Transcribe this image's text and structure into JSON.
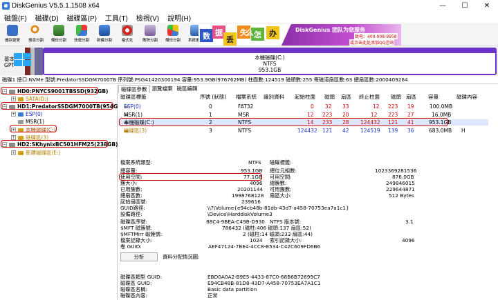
{
  "window": {
    "title": "DiskGenius V5.5.1.1508 x64"
  },
  "menu": [
    "磁盤(F)",
    "磁碟(D)",
    "磁碟區(P)",
    "工具(T)",
    "檢視(V)",
    "說明(H)"
  ],
  "toolbar": [
    "儲存變更",
    "搜尋分割",
    "備份分割",
    "快速分割",
    "新建分割",
    "格式化",
    "刪除分割",
    "備份分割",
    "系統遷移"
  ],
  "banner": {
    "cubes": [
      "数",
      "据",
      "丢",
      "失",
      "怎",
      "么",
      "办"
    ],
    "slogan": "DiskGenius 团队为您服务",
    "phone": "致电：400-008-9958",
    "qq": "或点击此处添加QQ咨询"
  },
  "diskmap": {
    "basic": "基本",
    "type": "GPT",
    "name": "本機磁碟(C:)",
    "fs": "NTFS",
    "size": "953.1GB"
  },
  "infobar": "磁碟1 接口:NVMe  型號:PredatorSSDGM7000TB  序列號:PSG41420300194  容量:953.9GB(976762MB)  柱面數:124519  磁頭數:255  每磁道扇區數:63  總扇區數:2000409264",
  "tree": {
    "d0": "HD0:PNYCS9001TBSSD(932GB)",
    "d0p1": "SATA(D:)",
    "d1": "HD1:PredatorSSDGM7000TB(954GB)",
    "d1p1": "ESP(0)",
    "d1p2": "MSR(1)",
    "d1p3": "本機磁碟(C:)",
    "d1p4": "磁碟區(3)",
    "d2": "HD2:SKhynixBC501HFM25(238GB)",
    "d2p1": "新建磁碟區(E:)"
  },
  "tabs": [
    "磁碟區參數",
    "瀏覽檔案",
    "磁區編輯"
  ],
  "table": {
    "headers": [
      "磁碟區標籤",
      "序號 (狀態)",
      "檔案系統",
      "識別資料",
      "起始柱面",
      "磁頭",
      "扇區",
      "終止柱面",
      "磁頭",
      "扇區",
      "容量",
      "磁碟內容"
    ],
    "rows": [
      {
        "label": "ESP(0)",
        "seq": "0",
        "fs": "FAT32",
        "sc": "0",
        "sh": "32",
        "ss": "33",
        "ec": "12",
        "eh": "223",
        "es": "19",
        "cap": "100.0MB",
        "attr": ""
      },
      {
        "label": "MSR(1)",
        "seq": "1",
        "fs": "MSR",
        "sc": "12",
        "sh": "223",
        "ss": "20",
        "ec": "12",
        "eh": "223",
        "es": "27",
        "cap": "16.0MB",
        "attr": ""
      },
      {
        "label": "本機磁碟(C:)",
        "seq": "2",
        "fs": "NTFS",
        "sc": "14",
        "sh": "233",
        "ss": "28",
        "ec": "124432",
        "eh": "121",
        "es": "41",
        "cap": "953.1GB",
        "attr": ""
      },
      {
        "label": "磁碟區(3)",
        "seq": "3",
        "fs": "NTFS",
        "sc": "124432",
        "sh": "121",
        "ss": "42",
        "ec": "124519",
        "eh": "139",
        "es": "36",
        "cap": "683.0MB",
        "attr": "H"
      }
    ]
  },
  "details": {
    "fs_type_label": "檔案系統類型:",
    "fs_type": "NTFS",
    "vol_label_l": "磁碟標籤:",
    "cap_l": "總容量:",
    "cap": "953.1GB",
    "total_bytes_l": "總位元組數:",
    "total_bytes": "1023369281536",
    "used_l": "使用空間:",
    "used": "77.1GB",
    "free_l": "可用空間:",
    "free": "876.0GB",
    "cluster_l": "簇大小:",
    "cluster": "4096",
    "total_clusters_l": "總簇數:",
    "total_clusters": "249846015",
    "used_clusters_l": "已用簇數:",
    "used_clusters": "20201144",
    "free_clusters_l": "可用簇數:",
    "free_clusters": "229644871",
    "sectors_l": "總扇區數:",
    "sectors": "1998768128",
    "sector_size_l": "扇區大小:",
    "sector_size": "512 Bytes",
    "start_sector_l": "起始扇區號:",
    "start_sector": "239616",
    "guid_path_l": "GUID路徑:",
    "guid_path": "\\\\?\\Volume{e94cb48b-81db-43d7-a458-70753ea7a1c1}",
    "device_path_l": "設備路徑:",
    "device_path": "\\Device\\HarddiskVolume3",
    "serial_l": "磁碟區序號:",
    "serial": "88C4-9BEA-C49B-D930",
    "ntfs_ver_l": "NTFS 版本號:",
    "ntfs_ver": "3.1",
    "mft_l": "$MFT 磁簇號:",
    "mft": "786432 (磁柱:406 磁頭:137 扇區:52)",
    "mftmirr_l": "$MFTMirr 磁簇號:",
    "mftmirr": "2 (磁柱:14 磁頭:233 扇區:44)",
    "frs_l": "檔案記錄大小:",
    "frs": "1024",
    "idx_l": "索引記錄大小:",
    "idx": "4096",
    "vol_guid_l": "卷 GUID:",
    "vol_guid": "AEF47124-7BE4-4CC8-B534-C42C609FD6B6",
    "analyze": "分析",
    "alloc_l": "資料分配情況圖:",
    "ptype_guid_l": "磁碟區類型 GUID:",
    "ptype_guid": "EBD0A0A2-B9E5-4433-87C0-68B6B72699C7",
    "pguid_l": "磁碟區 GUID:",
    "pguid": "E94CB48B-81D8-43D7-A458-70753EA7A1C1",
    "pname_l": "磁碟區名稱:",
    "pname": "Basic data partition",
    "pattr_l": "磁碟區內容:",
    "pattr": "正常"
  }
}
